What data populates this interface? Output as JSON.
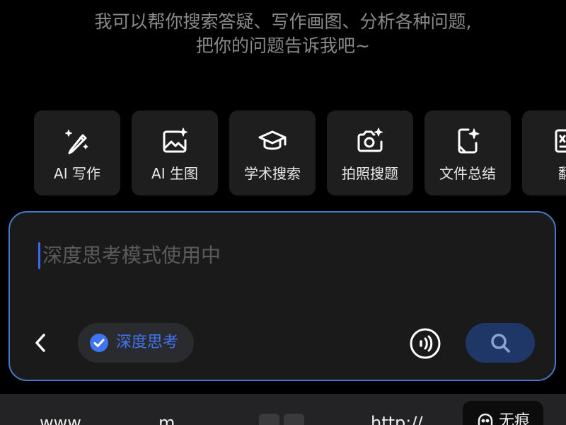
{
  "intro": {
    "line1": "我可以帮你搜索答疑、写作画图、分析各种问题,",
    "line2": "把你的问题告诉我吧~"
  },
  "tools": [
    {
      "label": "AI 写作",
      "icon": "magic-pen-icon"
    },
    {
      "label": "AI 生图",
      "icon": "image-sparkle-icon"
    },
    {
      "label": "学术搜索",
      "icon": "graduation-cap-icon"
    },
    {
      "label": "拍照搜题",
      "icon": "camera-icon"
    },
    {
      "label": "文件总结",
      "icon": "file-sparkle-icon"
    },
    {
      "label": "翻",
      "icon": "translate-icon"
    }
  ],
  "composer": {
    "placeholder": "深度思考模式使用中",
    "deep_think_label": "深度思考",
    "icons": {
      "back": "chevron-left-icon",
      "check": "check-circle-icon",
      "voice": "voice-icon",
      "search": "search-icon"
    }
  },
  "bottom_bar": {
    "item1": "www.",
    "item2": "m.",
    "item3": "http://",
    "incognito_label": "无痕"
  },
  "colors": {
    "background": "#000000",
    "card": "#1e1e1f",
    "accent": "#3f74f2",
    "composer_border": "#4a78c8",
    "search_button": "#1f3766"
  }
}
